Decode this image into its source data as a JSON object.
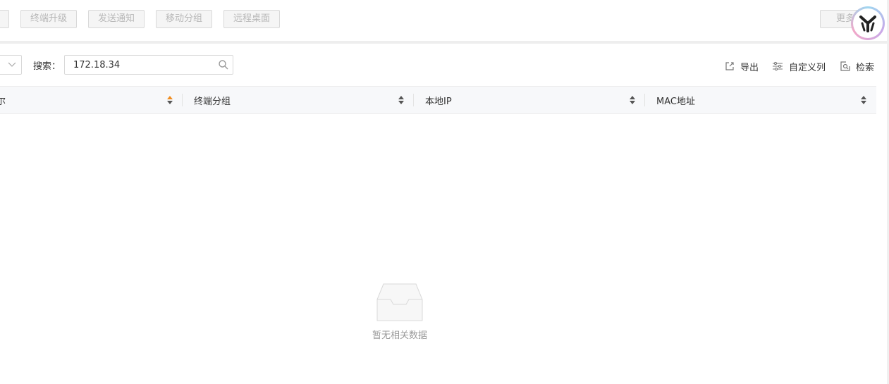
{
  "toolbar": {
    "buttons": [
      "终端升级",
      "发送通知",
      "移动分组",
      "远程桌面"
    ],
    "more_label": "更多"
  },
  "search": {
    "label": "搜索：",
    "value": "172.18.34"
  },
  "actions": {
    "export": "导出",
    "custom_columns": "自定义列",
    "retrieve": "检索"
  },
  "table": {
    "columns": [
      "终端分组",
      "本地IP",
      "MAC地址"
    ],
    "first_column_fragment": "尔",
    "empty_text": "暂无相关数据"
  },
  "colors": {
    "sort_active": "#f08c1e",
    "sort_inactive": "#555555"
  }
}
